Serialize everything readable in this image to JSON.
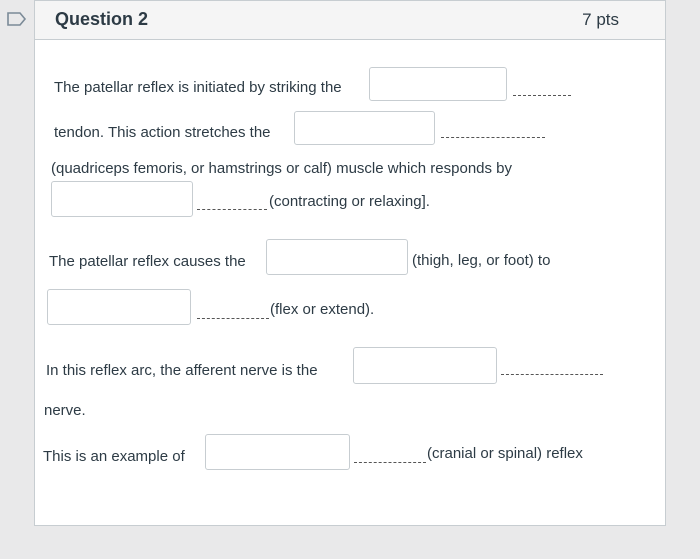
{
  "question": {
    "title": "Question 2",
    "points": "7 pts"
  },
  "lines": {
    "l1": "The patellar reflex is initiated by striking the",
    "l2": "tendon. This action stretches the",
    "l3": "(quadriceps femoris, or hamstrings or calf) muscle which responds by",
    "l4": "(contracting or relaxing].",
    "l5": "The patellar reflex causes the",
    "l6": "(thigh, leg, or foot) to",
    "l7": "(flex or extend).",
    "l8": "In this reflex arc, the afferent nerve is the",
    "l9": "nerve.",
    "l10": "This is an example of",
    "l11": "(cranial or spinal) reflex"
  },
  "answers": {
    "blank1": "",
    "blank2": "",
    "blank3": "",
    "blank4": "",
    "blank5": "",
    "blank6": "",
    "blank7": ""
  },
  "colors": {
    "flag": "#7b8a97",
    "border": "#c7cdd1"
  },
  "icons": {
    "flag": "bookmark-flag-icon"
  }
}
